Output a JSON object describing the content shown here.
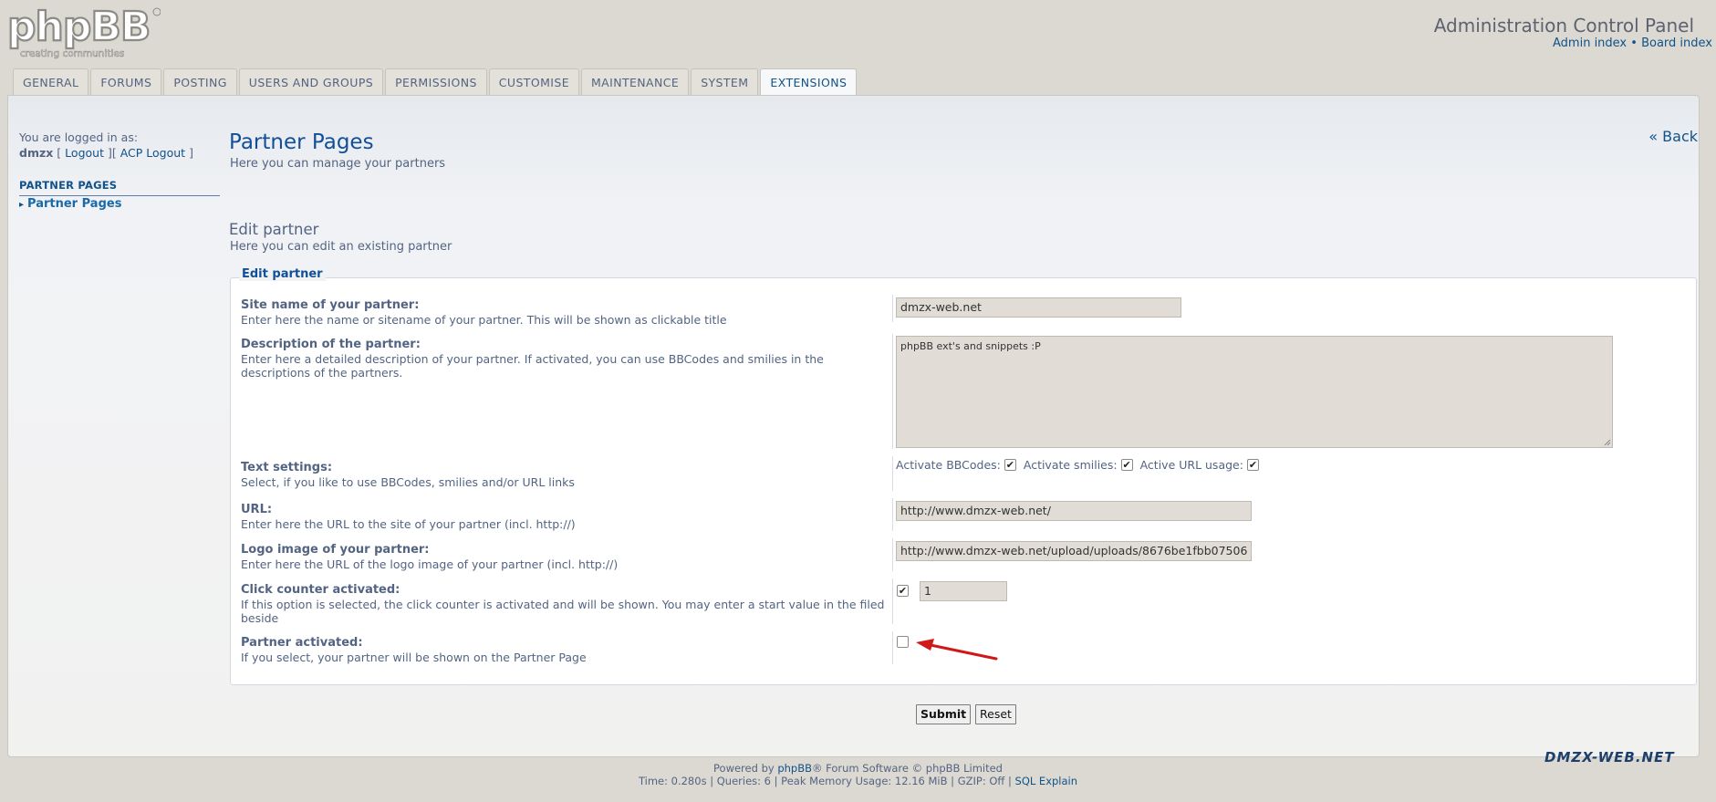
{
  "brand": {
    "logo_text": "phpBB",
    "tagline": "creating communities"
  },
  "header": {
    "title": "Administration Control Panel",
    "admin_index": "Admin index",
    "separator": "•",
    "board_index": "Board index"
  },
  "tabs": [
    {
      "label": "GENERAL"
    },
    {
      "label": "FORUMS"
    },
    {
      "label": "POSTING"
    },
    {
      "label": "USERS AND GROUPS"
    },
    {
      "label": "PERMISSIONS"
    },
    {
      "label": "CUSTOMISE"
    },
    {
      "label": "MAINTENANCE"
    },
    {
      "label": "SYSTEM"
    },
    {
      "label": "EXTENSIONS",
      "active": true
    }
  ],
  "sidebar": {
    "logged_in_as": "You are logged in as:",
    "username": "dmzx",
    "logout": "Logout",
    "acp_logout": "ACP Logout",
    "section_heading": "PARTNER PAGES",
    "items": [
      {
        "label": "Partner Pages"
      }
    ]
  },
  "page": {
    "title": "Partner Pages",
    "description": "Here you can manage your partners",
    "back": "« Back",
    "edit_title": "Edit partner",
    "edit_description": "Here you can edit an existing partner",
    "legend": "Edit partner"
  },
  "form": {
    "site_name": {
      "label": "Site name of your partner:",
      "explain": "Enter here the name or sitename of your partner. This will be shown as clickable title",
      "value": "dmzx-web.net"
    },
    "description": {
      "label": "Description of the partner:",
      "explain": "Enter here a detailed description of your partner. If activated, you can use BBCodes and smilies in the descriptions of the partners.",
      "value": "phpBB ext's and snippets :P"
    },
    "text_settings": {
      "label": "Text settings:",
      "explain": "Select, if you like to use BBCodes, smilies and/or URL links",
      "bbcodes_label": "Activate BBCodes:",
      "bbcodes_checked": true,
      "smilies_label": "Activate smilies:",
      "smilies_checked": true,
      "url_label": "Active URL usage:",
      "url_checked": true
    },
    "url": {
      "label": "URL:",
      "explain": "Enter here the URL to the site of your partner (incl. http://)",
      "value": "http://www.dmzx-web.net/"
    },
    "logo": {
      "label": "Logo image of your partner:",
      "explain": "Enter here the URL of the logo image of your partner (incl. http://)",
      "value": "http://www.dmzx-web.net/upload/uploads/8676be1fbb07506"
    },
    "click_counter": {
      "label": "Click counter activated:",
      "explain": "If this option is selected, the click counter is activated and will be shown. You may enter a start value in the filed beside",
      "checked": true,
      "value": "1"
    },
    "partner_active": {
      "label": "Partner activated:",
      "explain": "If you select, your partner will be shown on the Partner Page",
      "checked": false
    },
    "submit": "Submit",
    "reset": "Reset"
  },
  "footer": {
    "powered_prefix": "Powered by",
    "phpbb_link": "phpBB",
    "powered_suffix": "® Forum Software © phpBB Limited",
    "stats": "Time: 0.280s | Queries: 6 | Peak Memory Usage: 12.16 MiB | GZIP: Off |",
    "sql_explain": "SQL Explain"
  },
  "watermark": "DMZX-WEB.NET",
  "colors": {
    "page_bg": "#dcd9d2",
    "link": "#105289",
    "title": "#115098",
    "text": "#536482",
    "arrow": "#d01818"
  }
}
